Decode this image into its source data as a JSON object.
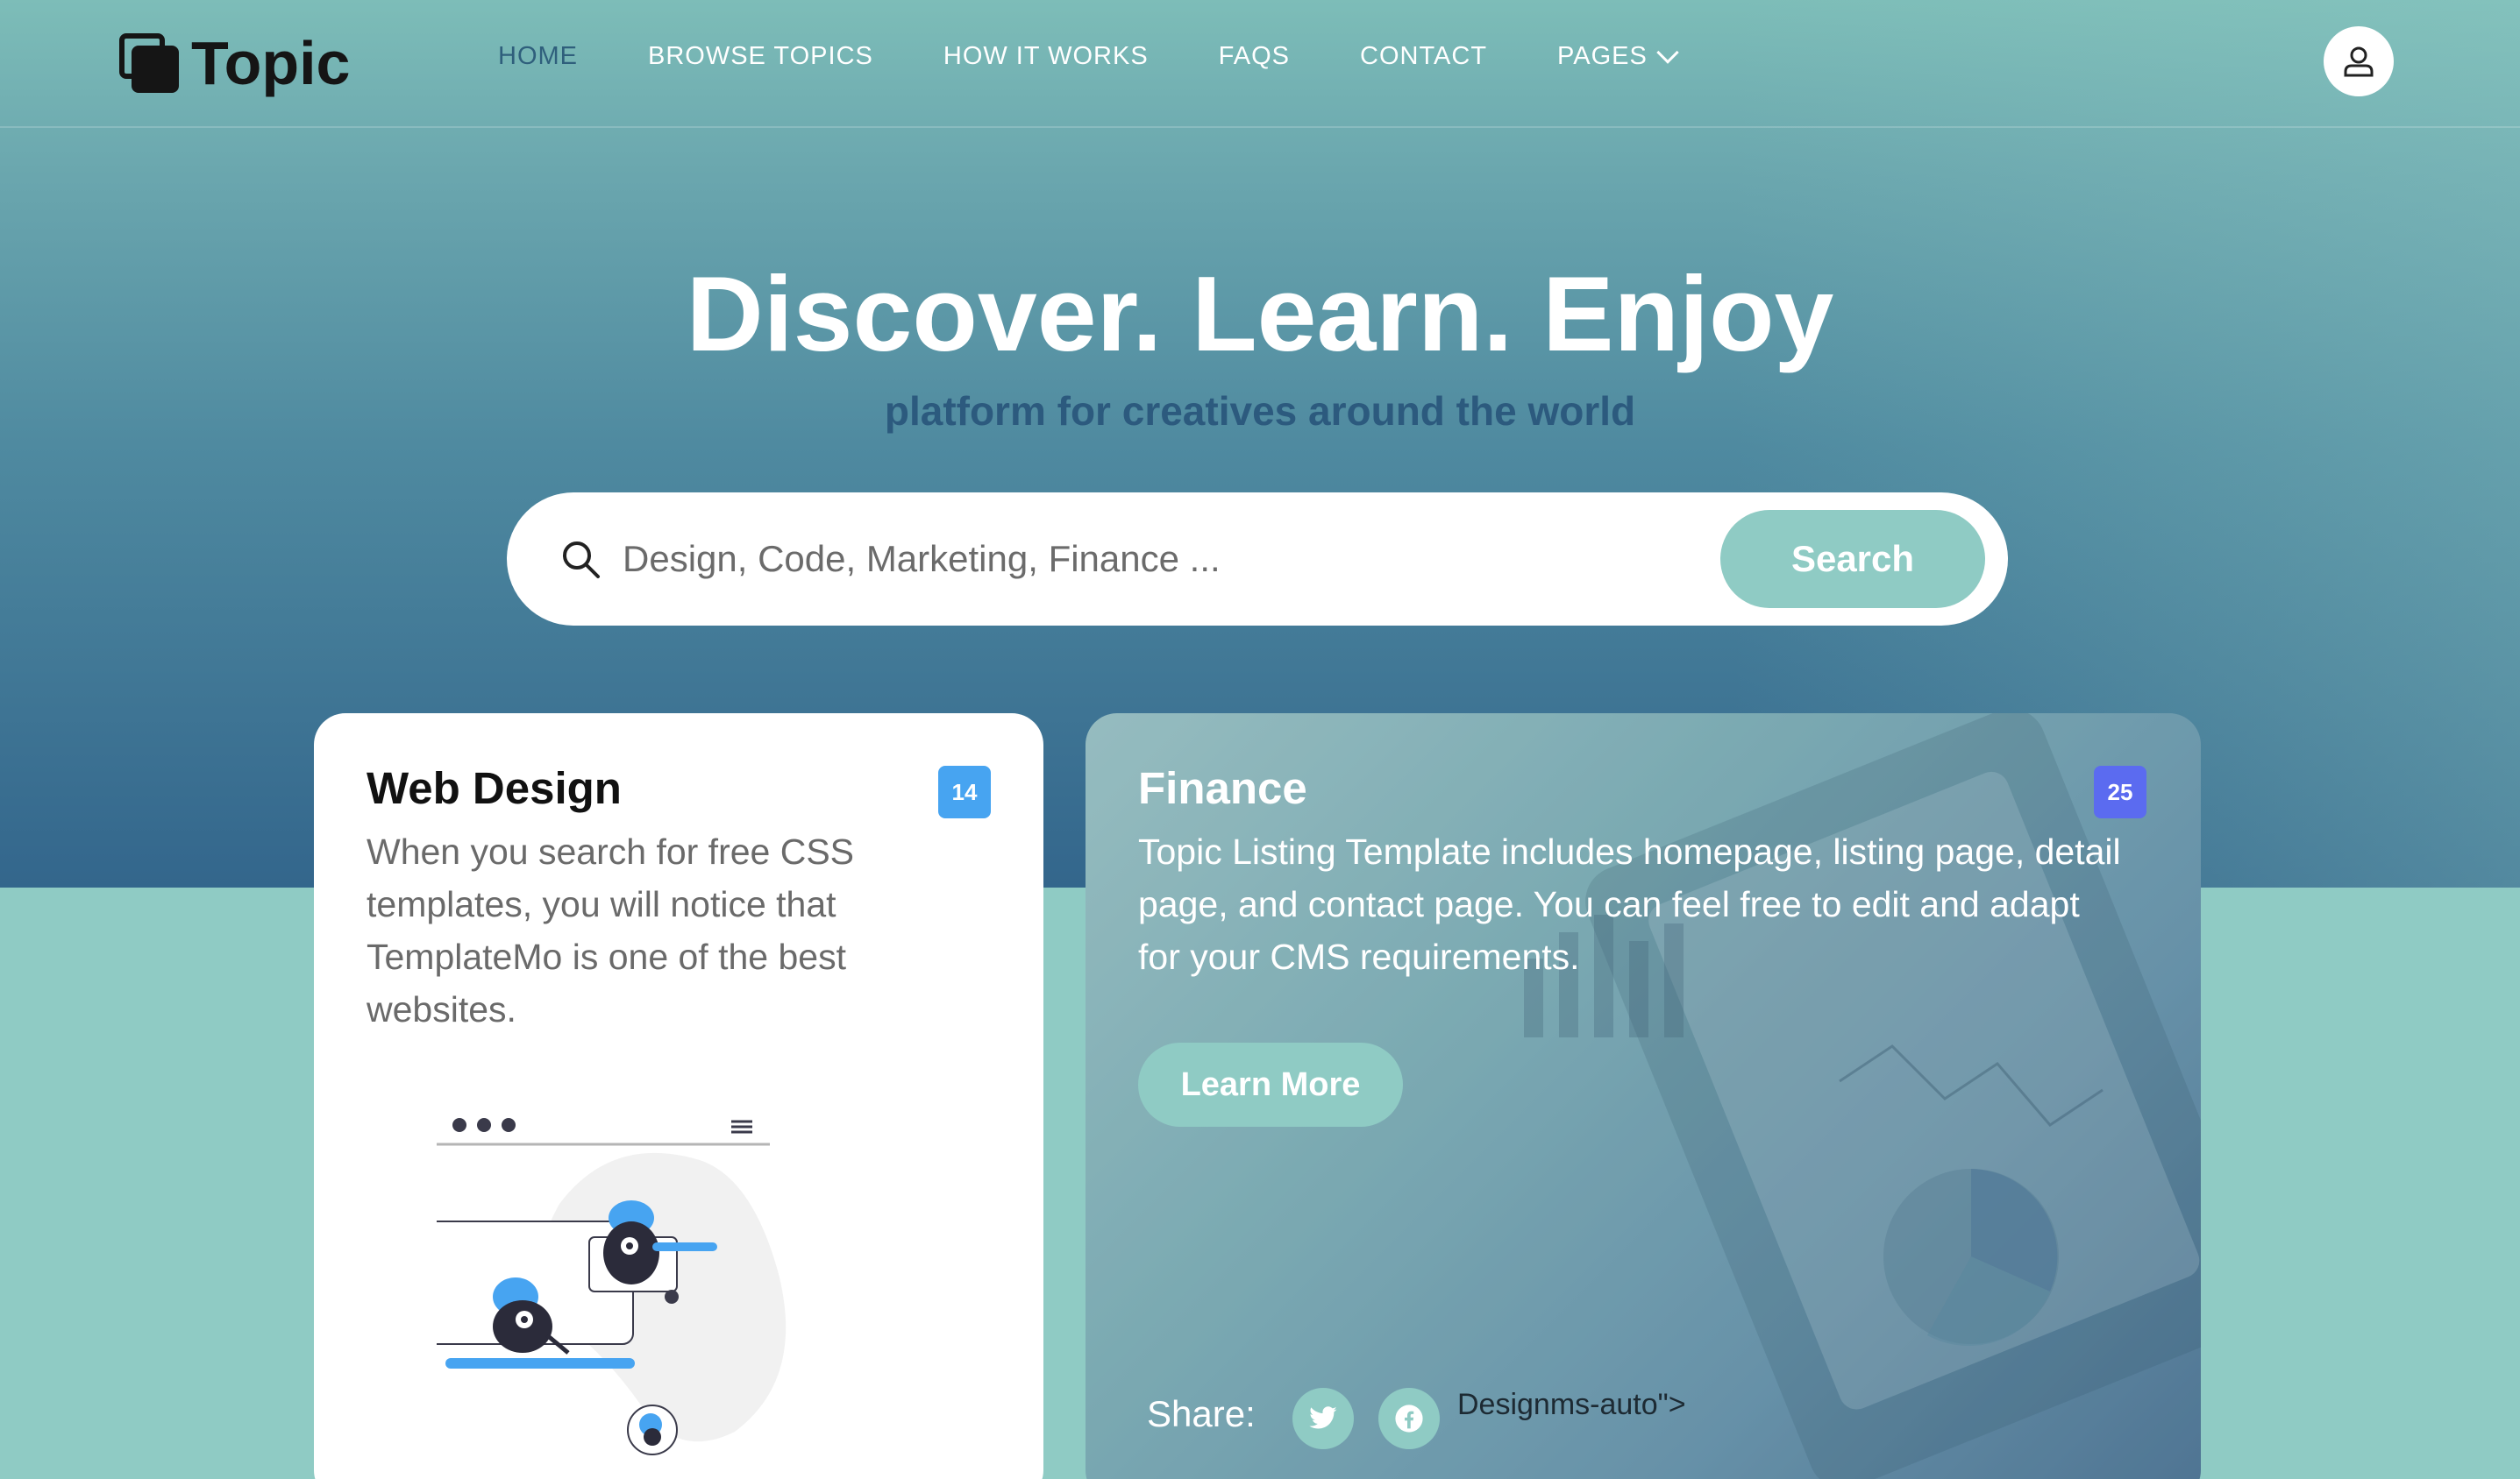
{
  "brand": {
    "name": "Topic"
  },
  "nav": {
    "items": [
      {
        "label": "HOME",
        "active": true
      },
      {
        "label": "BROWSE TOPICS"
      },
      {
        "label": "HOW IT WORKS"
      },
      {
        "label": "FAQS"
      },
      {
        "label": "CONTACT"
      },
      {
        "label": "PAGES",
        "has_dropdown": true
      }
    ],
    "user_icon": "user-icon"
  },
  "hero": {
    "title": "Discover. Learn. Enjoy",
    "subtitle": "platform for creatives around the world",
    "search": {
      "placeholder": "Design, Code, Marketing, Finance ...",
      "button_label": "Search"
    }
  },
  "cards": {
    "web_design": {
      "title": "Web Design",
      "badge": "14",
      "text": "When you search for free CSS templates, you will notice that TemplateMo is one of the best websites."
    },
    "finance": {
      "title": "Finance",
      "badge": "25",
      "text": "Topic Listing Template includes homepage, listing page, detail page, and contact page. You can feel free to edit and adapt for your CMS requirements.",
      "button_label": "Learn More",
      "share_label": "Share:",
      "share_extra": "Designms-auto\">"
    }
  },
  "colors": {
    "accent": "#8fcbc4",
    "nav_active": "#2f5f7c",
    "badge_web": "#47a4f1",
    "badge_finance": "#5b6bf0"
  }
}
